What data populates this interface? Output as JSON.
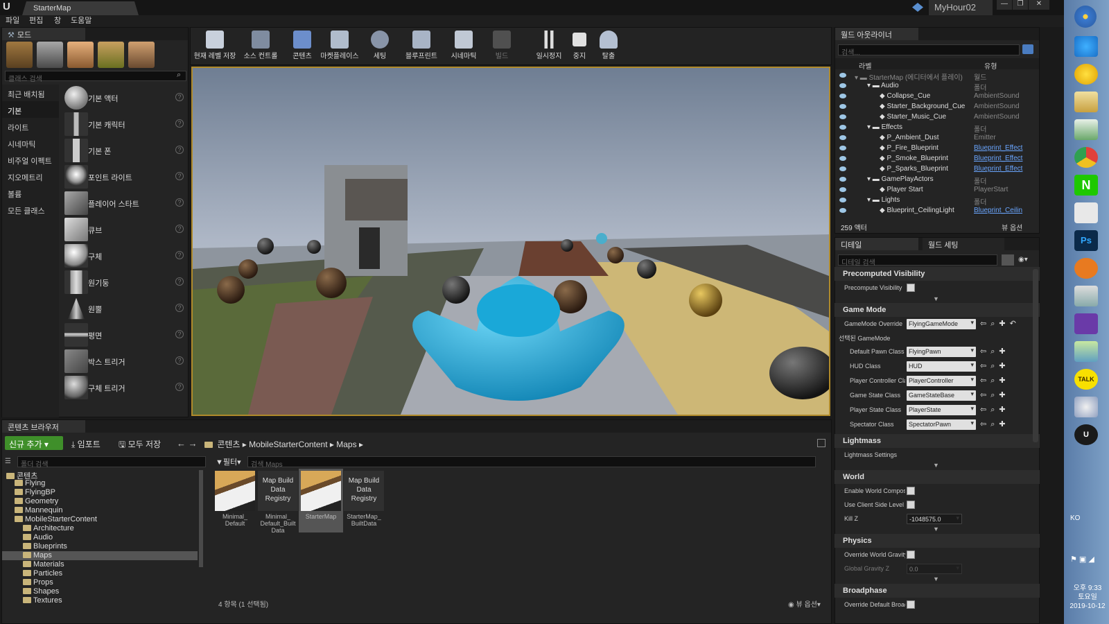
{
  "app": {
    "map_tab": "StarterMap",
    "project": "MyHour02",
    "window_buttons": [
      "—",
      "❐",
      "✕"
    ]
  },
  "menu": [
    "파일",
    "편집",
    "창",
    "도움말"
  ],
  "modes": {
    "tab_label": "모드",
    "search_placeholder": "클래스 검색",
    "categories": [
      "최근 배치됨",
      "기본",
      "라이트",
      "시네마틱",
      "비주얼 이펙트",
      "지오메트리",
      "볼륨",
      "모든 클래스"
    ],
    "items": [
      "기본 액터",
      "기본 캐릭터",
      "기본 폰",
      "포인트 라이트",
      "플레이어 스타트",
      "큐브",
      "구체",
      "원기둥",
      "원뿔",
      "평면",
      "박스 트리거",
      "구체 트리거"
    ]
  },
  "toolbar": [
    {
      "label": "현재 레벨 저장"
    },
    {
      "label": "소스 컨트롤"
    },
    {
      "label": "콘텐츠"
    },
    {
      "label": "마켓플레이스"
    },
    {
      "label": "세팅"
    },
    {
      "label": "블루프린트"
    },
    {
      "label": "시네마틱"
    },
    {
      "label": "빌드"
    },
    {
      "label": "일시정지"
    },
    {
      "label": "중지"
    },
    {
      "label": "탈출"
    }
  ],
  "outliner": {
    "tab_label": "월드 아웃라이너",
    "search_placeholder": "검색...",
    "col_label": "라벨",
    "col_type": "유형",
    "rows": [
      {
        "label": "StarterMap (에디터에서 플레이)",
        "type": "월드",
        "indent": 0,
        "link": false
      },
      {
        "label": "Audio",
        "type": "폴더",
        "indent": 1,
        "link": false
      },
      {
        "label": "Collapse_Cue",
        "type": "AmbientSound",
        "indent": 2,
        "link": false
      },
      {
        "label": "Starter_Background_Cue",
        "type": "AmbientSound",
        "indent": 2,
        "link": false
      },
      {
        "label": "Starter_Music_Cue",
        "type": "AmbientSound",
        "indent": 2,
        "link": false
      },
      {
        "label": "Effects",
        "type": "폴더",
        "indent": 1,
        "link": false
      },
      {
        "label": "P_Ambient_Dust",
        "type": "Emitter",
        "indent": 2,
        "link": false
      },
      {
        "label": "P_Fire_Blueprint",
        "type": "Blueprint_Effect",
        "indent": 2,
        "link": true
      },
      {
        "label": "P_Smoke_Blueprint",
        "type": "Blueprint_Effect",
        "indent": 2,
        "link": true
      },
      {
        "label": "P_Sparks_Blueprint",
        "type": "Blueprint_Effect",
        "indent": 2,
        "link": true
      },
      {
        "label": "GamePlayActors",
        "type": "폴더",
        "indent": 1,
        "link": false
      },
      {
        "label": "Player Start",
        "type": "PlayerStart",
        "indent": 2,
        "link": false
      },
      {
        "label": "Lights",
        "type": "폴더",
        "indent": 1,
        "link": false
      },
      {
        "label": "Blueprint_CeilingLight",
        "type": "Blueprint_Ceilin",
        "indent": 2,
        "link": true
      }
    ],
    "actor_count": "259 액터",
    "view_options": "뷰 옵션"
  },
  "details": {
    "tab_details": "디테일",
    "tab_world": "월드 세팅",
    "search_placeholder": "디테일 검색",
    "sections": {
      "precomputed": "Precomputed Visibility",
      "gamemode": "Game Mode",
      "lightmass": "Lightmass",
      "world": "World",
      "physics": "Physics",
      "broadphase": "Broadphase"
    },
    "precompute_label": "Precompute Visibility",
    "gamemode_override_label": "GameMode Override",
    "gamemode_override_value": "FlyingGameMode",
    "selected_gamemode": "선택된 GameMode",
    "gm_rows": [
      {
        "label": "Default Pawn Class",
        "value": "FlyingPawn"
      },
      {
        "label": "HUD Class",
        "value": "HUD"
      },
      {
        "label": "Player Controller Class",
        "value": "PlayerController"
      },
      {
        "label": "Game State Class",
        "value": "GameStateBase"
      },
      {
        "label": "Player State Class",
        "value": "PlayerState"
      },
      {
        "label": "Spectator Class",
        "value": "SpectatorPawn"
      }
    ],
    "lightmass_settings": "Lightmass Settings",
    "enable_world_composition": "Enable World Composition",
    "use_client_side_level": "Use Client Side Level",
    "kill_z_label": "Kill Z",
    "kill_z_value": "-1048575.0",
    "override_world_gravity": "Override World Gravity",
    "global_gravity_z_label": "Global Gravity Z",
    "global_gravity_z_value": "0.0",
    "override_default_broadphase": "Override Default Broadphase"
  },
  "content_browser": {
    "tab_label": "콘텐츠 브라우저",
    "add_new": "신규 추가",
    "import": "임포트",
    "save_all": "모두 저장",
    "path": [
      "콘텐츠",
      "MobileStarterContent",
      "Maps"
    ],
    "folder_search_placeholder": "폴더 검색",
    "filters": "필터",
    "asset_search_placeholder": "검색 Maps",
    "tree": [
      {
        "label": "콘텐츠",
        "indent": 0,
        "selected": false
      },
      {
        "label": "Flying",
        "indent": 1,
        "selected": false
      },
      {
        "label": "FlyingBP",
        "indent": 1,
        "selected": false
      },
      {
        "label": "Geometry",
        "indent": 1,
        "selected": false
      },
      {
        "label": "Mannequin",
        "indent": 1,
        "selected": false
      },
      {
        "label": "MobileStarterContent",
        "indent": 1,
        "selected": false
      },
      {
        "label": "Architecture",
        "indent": 2,
        "selected": false
      },
      {
        "label": "Audio",
        "indent": 2,
        "selected": false
      },
      {
        "label": "Blueprints",
        "indent": 2,
        "selected": false
      },
      {
        "label": "Maps",
        "indent": 2,
        "selected": true
      },
      {
        "label": "Materials",
        "indent": 2,
        "selected": false
      },
      {
        "label": "Particles",
        "indent": 2,
        "selected": false
      },
      {
        "label": "Props",
        "indent": 2,
        "selected": false
      },
      {
        "label": "Shapes",
        "indent": 2,
        "selected": false
      },
      {
        "label": "Textures",
        "indent": 2,
        "selected": false
      }
    ],
    "assets": [
      {
        "thumb": "map",
        "label": "Minimal_\nDefault",
        "selected": false
      },
      {
        "thumb": "text",
        "thumb_text": "Map Build\nData\nRegistry",
        "label": "Minimal_\nDefault_Built\nData",
        "selected": false
      },
      {
        "thumb": "map",
        "label": "StarterMap",
        "selected": true
      },
      {
        "thumb": "text",
        "thumb_text": "Map Build\nData\nRegistry",
        "label": "StarterMap_\nBuiltData",
        "selected": false
      }
    ],
    "status": "4 항목 (1 선택됨)",
    "view_options": "뷰 옵션"
  },
  "taskbar": {
    "ime_ko": "KO",
    "time": "오후 9:33",
    "day": "토요일",
    "date": "2019-10-12"
  },
  "colors": {
    "accent_orange": "#b08a2a",
    "link_blue": "#6aa6ff",
    "add_green": "#3f8f2a"
  }
}
